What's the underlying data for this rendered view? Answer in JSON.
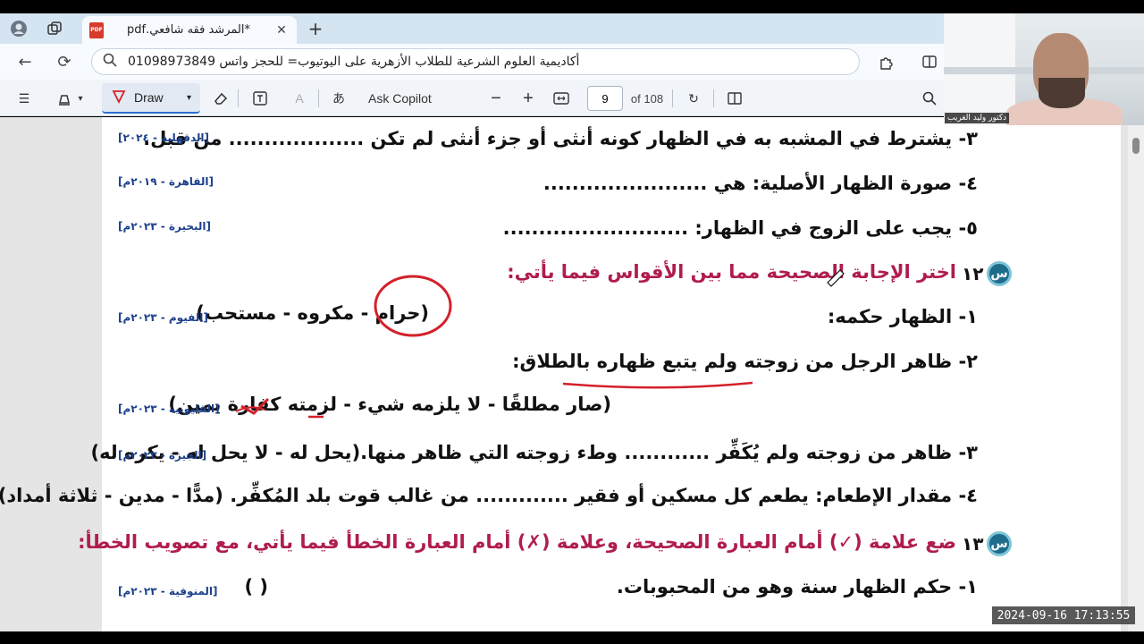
{
  "browser": {
    "tab": {
      "title": "*المرشد فقه شافعي.pdf",
      "icon": "pdf-icon"
    },
    "address": "أكاديمية العلوم الشرعية للطلاب الأزهرية على اليوتيوب= للحجز واتس 01098973849"
  },
  "toolbar": {
    "draw_label": "Draw",
    "copilot_label": "Ask Copilot",
    "page_current": "9",
    "page_total": "of 108",
    "pdf_badge": "PDF"
  },
  "content": {
    "lines": [
      {
        "text": "٣- يشترط في المشبه به في الظهار كونه أنثى أو جزء أنثى لم تكن ................... من قبل.",
        "source": "[الدقهلية - ٢٠٢٤]"
      },
      {
        "text": "٤- صورة الظهار الأصلية: هي .......................",
        "source": "[القاهرة - ٢٠١٩م]"
      },
      {
        "text": "٥- يجب على الزوج في الظهار: ..........................",
        "source": "[البحيرة - ٢٠٢٣م]"
      },
      {
        "text": "١- الظهار حكمه:",
        "source": ""
      },
      {
        "text": "٢- ظاهر الرجل من زوجته ولم يتبع ظهاره بالطلاق:",
        "source": ""
      },
      {
        "text": "(صار مطلقًا - لا يلزمه شيء - لزمته كفارة يمين)",
        "source": "[القليوبية - ٢٠٢٣م]"
      },
      {
        "text": "٣- ظاهر من زوجته ولم يُكَفِّر ............ وطء زوجته التي ظاهر منها.(يحل له - لا يحل له - يكره له)",
        "source": "[الجيزة - ٢٠٢٣م]"
      },
      {
        "text": "٤- مقدار الإطعام: يطعم كل مسكين أو فقير ............. من غالب قوت بلد المُكفِّر. (مدًّا - مدين - ثلاثة أمداد)",
        "source": ""
      },
      {
        "text": "١- حكم الظهار سنة وهو من المحبوبات.",
        "source": "[المنوفية - ٢٠٢٣م]"
      }
    ],
    "q12": {
      "number": "١٢",
      "title": "اختر الإجابة الصحيحة مما بين الأقواس فيما يأتي:",
      "options": "(حرام - مكروه - مستحب)",
      "options_source": "[الفيوم - ٢٠٢٣م]"
    },
    "q13": {
      "number": "١٣",
      "title": "ضع علامة (✓) أمام العبارة الصحيحة، وعلامة (✗) أمام العبارة الخطأ فيما يأتي، مع تصويب الخطأ:"
    },
    "blank_parens": "(      )",
    "q_icon": "س"
  },
  "webcam": {
    "label": "دكتور وليد الغريب"
  },
  "clock": "2024-09-16  17:13:55",
  "colors": {
    "question_title": "#b01c4f",
    "source": "#1b3f8b",
    "ink": "#d42029"
  }
}
